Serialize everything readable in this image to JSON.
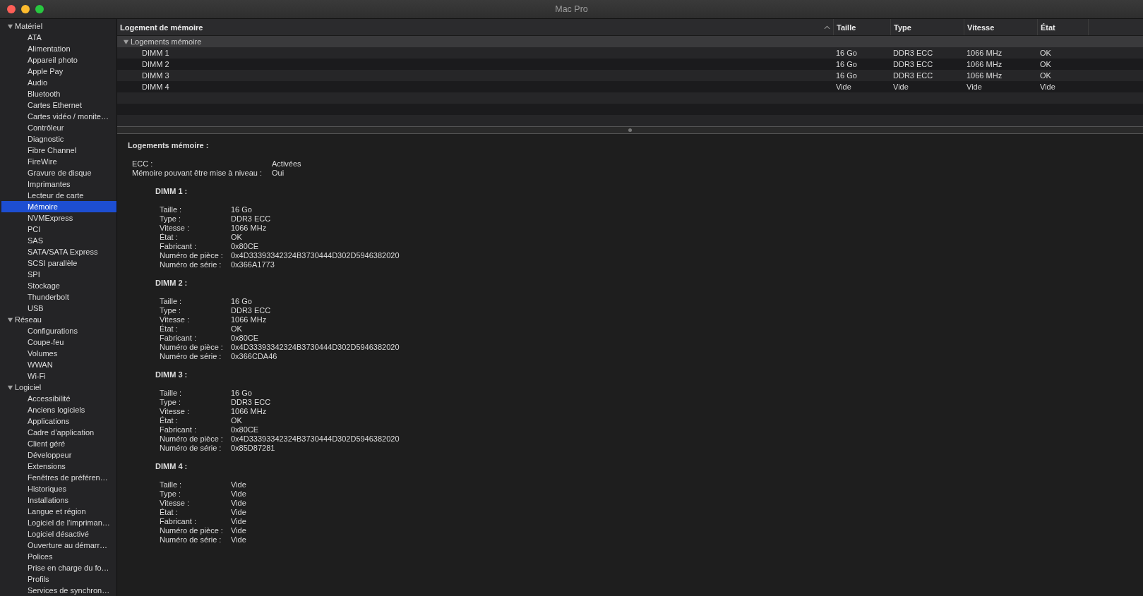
{
  "window": {
    "title": "Mac Pro"
  },
  "sidebar": {
    "groups": [
      {
        "label": "Matériel",
        "expanded": true,
        "children": [
          {
            "label": "ATA",
            "selected": false
          },
          {
            "label": "Alimentation",
            "selected": false
          },
          {
            "label": "Appareil photo",
            "selected": false
          },
          {
            "label": "Apple Pay",
            "selected": false
          },
          {
            "label": "Audio",
            "selected": false
          },
          {
            "label": "Bluetooth",
            "selected": false
          },
          {
            "label": "Cartes Ethernet",
            "selected": false
          },
          {
            "label": "Cartes vidéo / monite…",
            "selected": false
          },
          {
            "label": "Contrôleur",
            "selected": false
          },
          {
            "label": "Diagnostic",
            "selected": false
          },
          {
            "label": "Fibre Channel",
            "selected": false
          },
          {
            "label": "FireWire",
            "selected": false
          },
          {
            "label": "Gravure de disque",
            "selected": false
          },
          {
            "label": "Imprimantes",
            "selected": false
          },
          {
            "label": "Lecteur de carte",
            "selected": false
          },
          {
            "label": "Mémoire",
            "selected": true
          },
          {
            "label": "NVMExpress",
            "selected": false
          },
          {
            "label": "PCI",
            "selected": false
          },
          {
            "label": "SAS",
            "selected": false
          },
          {
            "label": "SATA/SATA Express",
            "selected": false
          },
          {
            "label": "SCSI parallèle",
            "selected": false
          },
          {
            "label": "SPI",
            "selected": false
          },
          {
            "label": "Stockage",
            "selected": false
          },
          {
            "label": "Thunderbolt",
            "selected": false
          },
          {
            "label": "USB",
            "selected": false
          }
        ]
      },
      {
        "label": "Réseau",
        "expanded": true,
        "children": [
          {
            "label": "Configurations",
            "selected": false
          },
          {
            "label": "Coupe-feu",
            "selected": false
          },
          {
            "label": "Volumes",
            "selected": false
          },
          {
            "label": "WWAN",
            "selected": false
          },
          {
            "label": "Wi-Fi",
            "selected": false
          }
        ]
      },
      {
        "label": "Logiciel",
        "expanded": true,
        "children": [
          {
            "label": "Accessibilité",
            "selected": false
          },
          {
            "label": "Anciens logiciels",
            "selected": false
          },
          {
            "label": "Applications",
            "selected": false
          },
          {
            "label": "Cadre d’application",
            "selected": false
          },
          {
            "label": "Client géré",
            "selected": false
          },
          {
            "label": "Développeur",
            "selected": false
          },
          {
            "label": "Extensions",
            "selected": false
          },
          {
            "label": "Fenêtres de préféren…",
            "selected": false
          },
          {
            "label": "Historiques",
            "selected": false
          },
          {
            "label": "Installations",
            "selected": false
          },
          {
            "label": "Langue et région",
            "selected": false
          },
          {
            "label": "Logiciel de l’impriman…",
            "selected": false
          },
          {
            "label": "Logiciel désactivé",
            "selected": false
          },
          {
            "label": "Ouverture au démarr…",
            "selected": false
          },
          {
            "label": "Polices",
            "selected": false
          },
          {
            "label": "Prise en charge du fo…",
            "selected": false
          },
          {
            "label": "Profils",
            "selected": false
          },
          {
            "label": "Services de synchron…",
            "selected": false
          }
        ]
      }
    ]
  },
  "table": {
    "columns": [
      {
        "label": "Logement de mémoire",
        "sorted": true
      },
      {
        "label": "Taille",
        "sorted": false
      },
      {
        "label": "Type",
        "sorted": false
      },
      {
        "label": "Vitesse",
        "sorted": false
      },
      {
        "label": "État",
        "sorted": false
      }
    ],
    "group": {
      "label": "Logements mémoire",
      "expanded": true
    },
    "rows": [
      {
        "cells": [
          "DIMM 1",
          "16 Go",
          "DDR3 ECC",
          "1066 MHz",
          "OK"
        ]
      },
      {
        "cells": [
          "DIMM 2",
          "16 Go",
          "DDR3 ECC",
          "1066 MHz",
          "OK"
        ]
      },
      {
        "cells": [
          "DIMM 3",
          "16 Go",
          "DDR3 ECC",
          "1066 MHz",
          "OK"
        ]
      },
      {
        "cells": [
          "DIMM 4",
          "Vide",
          "Vide",
          "Vide",
          "Vide"
        ]
      }
    ]
  },
  "details": {
    "title": "Logements mémoire :",
    "summary": [
      {
        "label": "ECC :",
        "value": "Activées"
      },
      {
        "label": "Mémoire pouvant être mise à niveau :",
        "value": "Oui"
      }
    ],
    "modules": [
      {
        "title": "DIMM 1 :",
        "fields": [
          {
            "label": "Taille :",
            "value": "16 Go"
          },
          {
            "label": "Type :",
            "value": "DDR3 ECC"
          },
          {
            "label": "Vitesse :",
            "value": "1066 MHz"
          },
          {
            "label": "État :",
            "value": "OK"
          },
          {
            "label": "Fabricant :",
            "value": "0x80CE"
          },
          {
            "label": "Numéro de pièce :",
            "value": "0x4D33393342324B3730444D302D5946382020"
          },
          {
            "label": "Numéro de série :",
            "value": "0x366A1773"
          }
        ]
      },
      {
        "title": "DIMM 2 :",
        "fields": [
          {
            "label": "Taille :",
            "value": "16 Go"
          },
          {
            "label": "Type :",
            "value": "DDR3 ECC"
          },
          {
            "label": "Vitesse :",
            "value": "1066 MHz"
          },
          {
            "label": "État :",
            "value": "OK"
          },
          {
            "label": "Fabricant :",
            "value": "0x80CE"
          },
          {
            "label": "Numéro de pièce :",
            "value": "0x4D33393342324B3730444D302D5946382020"
          },
          {
            "label": "Numéro de série :",
            "value": "0x366CDA46"
          }
        ]
      },
      {
        "title": "DIMM 3 :",
        "fields": [
          {
            "label": "Taille :",
            "value": "16 Go"
          },
          {
            "label": "Type :",
            "value": "DDR3 ECC"
          },
          {
            "label": "Vitesse :",
            "value": "1066 MHz"
          },
          {
            "label": "État :",
            "value": "OK"
          },
          {
            "label": "Fabricant :",
            "value": "0x80CE"
          },
          {
            "label": "Numéro de pièce :",
            "value": "0x4D33393342324B3730444D302D5946382020"
          },
          {
            "label": "Numéro de série :",
            "value": "0x85D87281"
          }
        ]
      },
      {
        "title": "DIMM 4 :",
        "fields": [
          {
            "label": "Taille :",
            "value": "Vide"
          },
          {
            "label": "Type :",
            "value": "Vide"
          },
          {
            "label": "Vitesse :",
            "value": "Vide"
          },
          {
            "label": "État :",
            "value": "Vide"
          },
          {
            "label": "Fabricant :",
            "value": "Vide"
          },
          {
            "label": "Numéro de pièce :",
            "value": "Vide"
          },
          {
            "label": "Numéro de série :",
            "value": "Vide"
          }
        ]
      }
    ]
  }
}
